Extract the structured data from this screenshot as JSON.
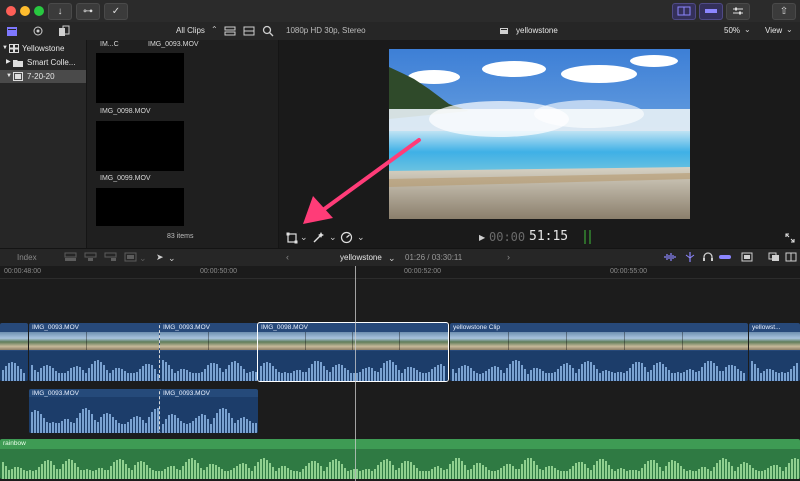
{
  "toolbar": {
    "import_icon": "↓",
    "keyword_icon": "⊶",
    "check_icon": "✓",
    "share_icon": "⇧"
  },
  "library": {
    "filter_label": "All Clips",
    "items": [
      "Yellowstone",
      "Smart Colle...",
      "7-20-20"
    ]
  },
  "browser": {
    "clips": [
      "IM...C",
      "IMG_0093.MOV",
      "IMG_0098.MOV",
      "IMG_0099.MOV"
    ],
    "item_count": "83 items"
  },
  "viewer": {
    "format": "1080p HD 30p, Stereo",
    "project_name": "yellowstone",
    "zoom": "50%",
    "view_label": "View",
    "timecode_dim": "00:00",
    "timecode": "51:15"
  },
  "timeline": {
    "index_label": "Index",
    "project_name": "yellowstone",
    "duration": "01:26 / 03:30:11",
    "ruler_ticks": [
      "00:00:48:00",
      "00:00:50:00",
      "00:00:52:00",
      "00:00:55:00"
    ],
    "primary_clips": [
      "IMG_0093.MOV",
      "IMG_0093.MOV",
      "IMG_0098.MOV",
      "yellowstone Clip",
      "yellowst..."
    ],
    "connected_clips": [
      "IMG_0093.MOV",
      "IMG_0093.MOV"
    ],
    "music_label": "rainbow"
  },
  "colors": {
    "accent": "#7e78ff",
    "arrow": "#ff3c78",
    "clip_blue": "#27497a",
    "music_green": "#3e9b54"
  }
}
